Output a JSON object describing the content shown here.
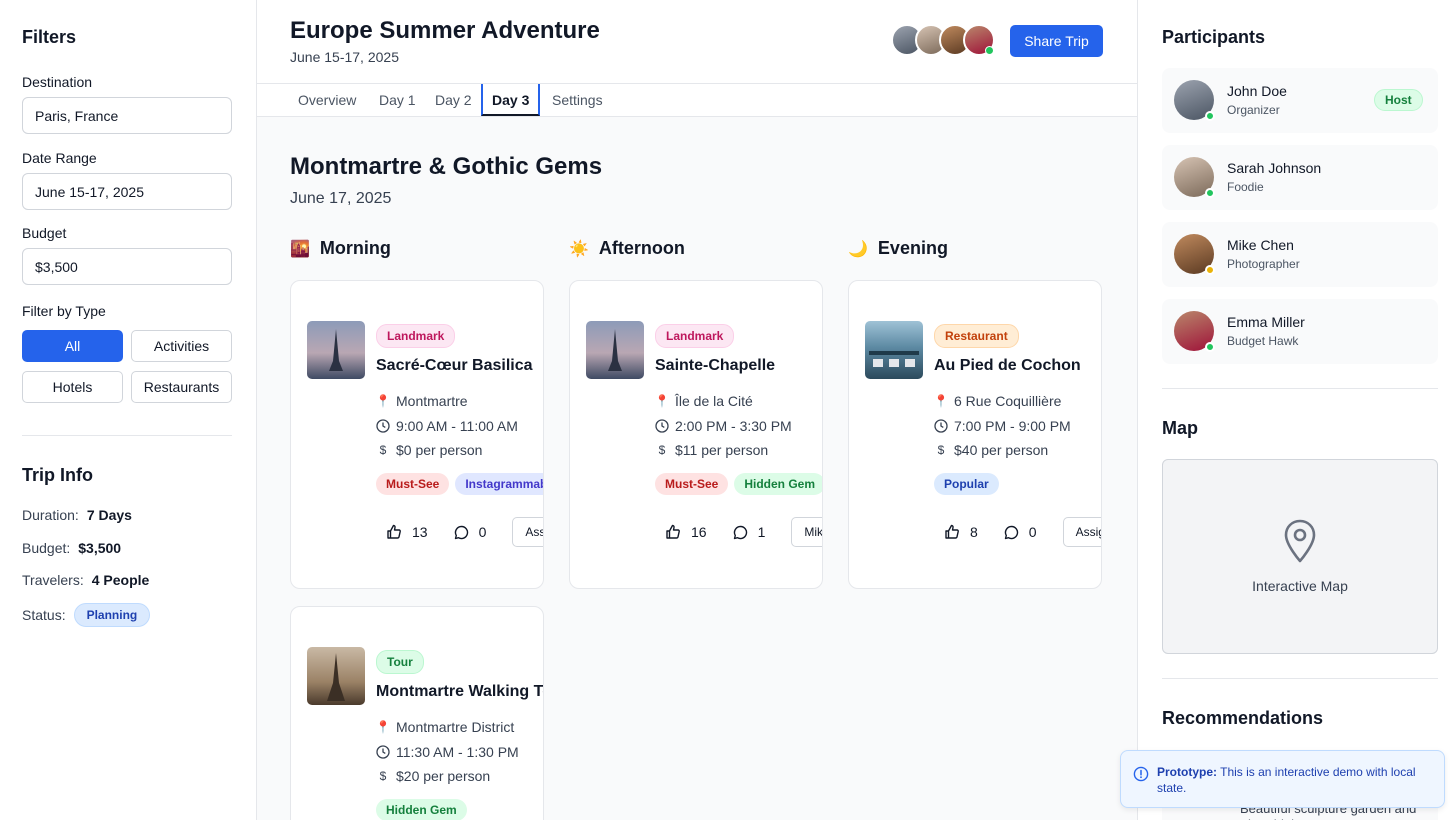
{
  "filters": {
    "title": "Filters",
    "destination_label": "Destination",
    "destination_value": "Paris, France",
    "date_label": "Date Range",
    "date_value": "June 15-17, 2025",
    "budget_label": "Budget",
    "budget_value": "$3,500",
    "type_label": "Filter by Type",
    "types": [
      "All",
      "Activities",
      "Hotels",
      "Restaurants"
    ],
    "active_type": "All"
  },
  "trip_info": {
    "title": "Trip Info",
    "rows": [
      {
        "label": "Duration:",
        "value": "7 Days"
      },
      {
        "label": "Budget:",
        "value": "$3,500"
      },
      {
        "label": "Travelers:",
        "value": "4 People"
      }
    ],
    "status_label": "Status:",
    "status_value": "Planning"
  },
  "header": {
    "title": "Europe Summer Adventure",
    "dates": "June 15-17, 2025",
    "share_label": "Share Trip"
  },
  "tabs": [
    "Overview",
    "Day 1",
    "Day 2",
    "Day 3",
    "Settings"
  ],
  "active_tab": "Day 3",
  "day": {
    "title": "Montmartre & Gothic Gems",
    "date": "June 17, 2025"
  },
  "slots": [
    {
      "emoji": "🌇",
      "label": "Morning"
    },
    {
      "emoji": "☀️",
      "label": "Afternoon"
    },
    {
      "emoji": "🌙",
      "label": "Evening"
    }
  ],
  "cards": [
    {
      "category": "Landmark",
      "category_style": "landmark",
      "name": "Sacré-Cœur Basilica",
      "location": "Montmartre",
      "time": "9:00 AM - 11:00 AM",
      "price": "$0 per person",
      "tags": [
        {
          "text": "Must-See",
          "style": "red"
        },
        {
          "text": "Instagrammable",
          "style": "indigo"
        }
      ],
      "likes": "13",
      "comments": "0",
      "assign": "Assign to..."
    },
    {
      "category": "Landmark",
      "category_style": "landmark",
      "name": "Sainte-Chapelle",
      "location": "Île de la Cité",
      "time": "2:00 PM - 3:30 PM",
      "price": "$11 per person",
      "tags": [
        {
          "text": "Must-See",
          "style": "red"
        },
        {
          "text": "Hidden Gem",
          "style": "green"
        }
      ],
      "likes": "16",
      "comments": "1",
      "assign": "Mike Chen"
    },
    {
      "category": "Restaurant",
      "category_style": "restaurant",
      "name": "Au Pied de Cochon",
      "location": "6 Rue Coquillière",
      "time": "7:00 PM - 9:00 PM",
      "price": "$40 per person",
      "tags": [
        {
          "text": "Popular",
          "style": "blue"
        }
      ],
      "likes": "8",
      "comments": "0",
      "assign": "Assign to..."
    },
    {
      "category": "Tour",
      "category_style": "tour",
      "name": "Montmartre Walking Tour",
      "location": "Montmartre District",
      "time": "11:30 AM - 1:30 PM",
      "price": "$20 per person",
      "tags": [
        {
          "text": "Hidden Gem",
          "style": "green"
        }
      ]
    }
  ],
  "participants": {
    "title": "Participants",
    "people": [
      {
        "name": "John Doe",
        "role": "Organizer",
        "badge": "Host",
        "status_color": "#22c55e"
      },
      {
        "name": "Sarah Johnson",
        "role": "Foodie",
        "status_color": "#22c55e"
      },
      {
        "name": "Mike Chen",
        "role": "Photographer",
        "status_color": "#eab308"
      },
      {
        "name": "Emma Miller",
        "role": "Budget Hawk",
        "status_color": "#22c55e"
      }
    ]
  },
  "map": {
    "title": "Map",
    "label": "Interactive Map"
  },
  "recommendations": {
    "title": "Recommendations",
    "peek_text": "Beautiful sculpture garden and The Thinker statue"
  },
  "toast": {
    "strong": "Prototype:",
    "text": " This is an interactive demo with local state."
  },
  "colors": {
    "accent": "#2563eb",
    "online": "#22c55e",
    "away": "#eab308"
  }
}
